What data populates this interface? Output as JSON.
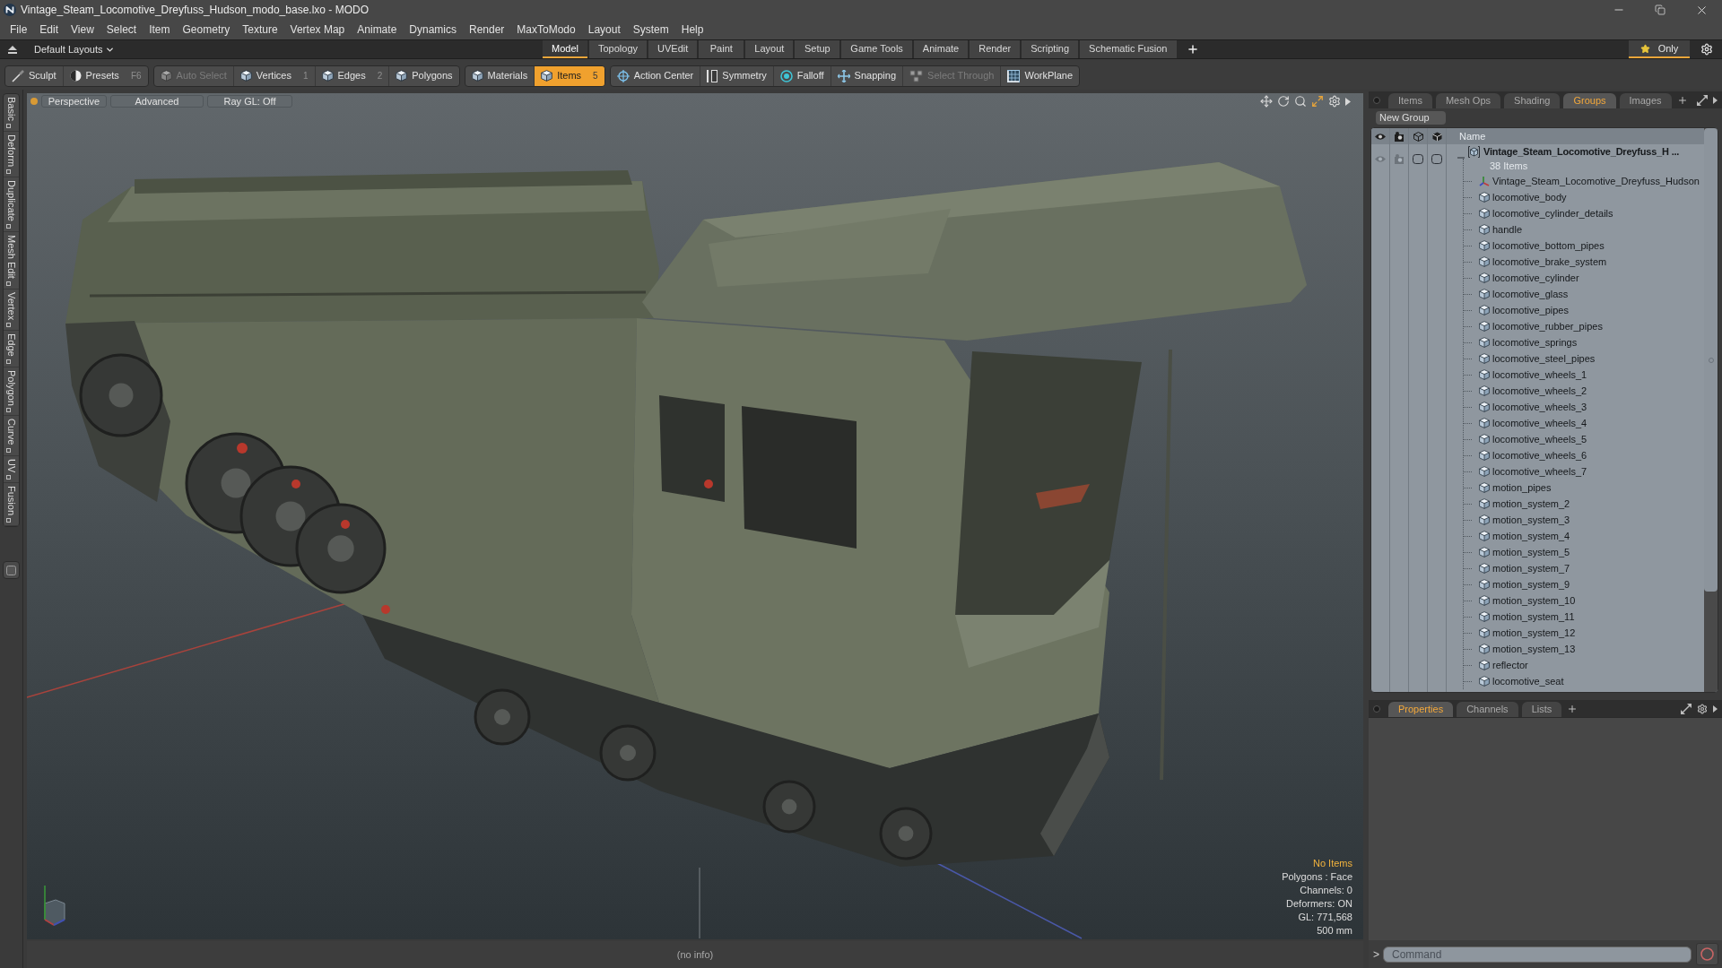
{
  "window": {
    "title": "Vintage_Steam_Locomotive_Dreyfuss_Hudson_modo_base.lxo - MODO"
  },
  "menu": [
    "File",
    "Edit",
    "View",
    "Select",
    "Item",
    "Geometry",
    "Texture",
    "Vertex Map",
    "Animate",
    "Dynamics",
    "Render",
    "MaxToModo",
    "Layout",
    "System",
    "Help"
  ],
  "layout_bar": {
    "layout_menu": "Default Layouts",
    "tabs": [
      {
        "label": "Model",
        "selected": true
      },
      {
        "label": "Topology",
        "selected": false
      },
      {
        "label": "UVEdit",
        "selected": false
      },
      {
        "label": "Paint",
        "selected": false
      },
      {
        "label": "Layout",
        "selected": false
      },
      {
        "label": "Setup",
        "selected": false
      },
      {
        "label": "Game Tools",
        "selected": false
      },
      {
        "label": "Animate",
        "selected": false
      },
      {
        "label": "Render",
        "selected": false
      },
      {
        "label": "Scripting",
        "selected": false
      },
      {
        "label": "Schematic Fusion",
        "selected": false
      }
    ],
    "only_button": {
      "label": "Only",
      "on": true
    }
  },
  "toolbar": {
    "groups": [
      {
        "items": [
          {
            "label": "Sculpt",
            "selected": false,
            "disabled": false
          },
          {
            "label": "Presets",
            "shortcut": "F6",
            "selected": false,
            "disabled": false
          }
        ]
      },
      {
        "items": [
          {
            "label": "Auto Select",
            "selected": false,
            "disabled": true
          },
          {
            "label": "Vertices",
            "shortcut": "1",
            "selected": false,
            "disabled": false
          },
          {
            "label": "Edges",
            "shortcut": "2",
            "selected": false,
            "disabled": false
          },
          {
            "label": "Polygons",
            "selected": false,
            "disabled": false
          }
        ]
      },
      {
        "items": [
          {
            "label": "Materials",
            "selected": false,
            "disabled": false
          },
          {
            "label": "Items",
            "shortcut": "5",
            "selected": true,
            "disabled": false
          }
        ]
      },
      {
        "items": [
          {
            "label": "Action Center",
            "selected": false,
            "disabled": false
          },
          {
            "label": "Symmetry",
            "selected": false,
            "disabled": false
          },
          {
            "label": "Falloff",
            "selected": false,
            "disabled": false
          },
          {
            "label": "Snapping",
            "selected": false,
            "disabled": false
          },
          {
            "label": "Select Through",
            "selected": false,
            "disabled": true
          },
          {
            "label": "WorkPlane",
            "selected": false,
            "disabled": false
          }
        ]
      }
    ]
  },
  "side_tabs": [
    "Basic",
    "Deform",
    "Duplicate",
    "Mesh Edit",
    "Vertex",
    "Edge",
    "Polygon",
    "Curve",
    "UV",
    "Fusion"
  ],
  "viewport": {
    "header": [
      "Perspective",
      "Advanced",
      "Ray GL: Off"
    ],
    "info": {
      "selection": "No Items",
      "lines": [
        "Polygons : Face",
        "Channels: 0",
        "Deformers: ON",
        "GL: 771,568",
        "500 mm"
      ]
    }
  },
  "status_bar": {
    "text": "(no info)"
  },
  "right_panel": {
    "tabs": [
      {
        "label": "Items",
        "selected": false
      },
      {
        "label": "Mesh Ops",
        "selected": false
      },
      {
        "label": "Shading",
        "selected": false
      },
      {
        "label": "Groups",
        "selected": true
      },
      {
        "label": "Images",
        "selected": false
      }
    ],
    "new_group_button": "New Group",
    "name_column": "Name",
    "groups": [
      {
        "name": "Vintage_Steam_Locomotive_Dreyfuss_H ...",
        "count": "38 Items",
        "expanded": true,
        "children": [
          {
            "label": "Vintage_Steam_Locomotive_Dreyfuss_Hudson",
            "kind": "locator"
          },
          {
            "label": "locomotive_body",
            "kind": "mesh"
          },
          {
            "label": "locomotive_cylinder_details",
            "kind": "mesh"
          },
          {
            "label": "handle",
            "kind": "mesh"
          },
          {
            "label": "locomotive_bottom_pipes",
            "kind": "mesh"
          },
          {
            "label": "locomotive_brake_system",
            "kind": "mesh"
          },
          {
            "label": "locomotive_cylinder",
            "kind": "mesh"
          },
          {
            "label": "locomotive_glass",
            "kind": "mesh"
          },
          {
            "label": "locomotive_pipes",
            "kind": "mesh"
          },
          {
            "label": "locomotive_rubber_pipes",
            "kind": "mesh"
          },
          {
            "label": "locomotive_springs",
            "kind": "mesh"
          },
          {
            "label": "locomotive_steel_pipes",
            "kind": "mesh"
          },
          {
            "label": "locomotive_wheels_1",
            "kind": "mesh"
          },
          {
            "label": "locomotive_wheels_2",
            "kind": "mesh"
          },
          {
            "label": "locomotive_wheels_3",
            "kind": "mesh"
          },
          {
            "label": "locomotive_wheels_4",
            "kind": "mesh"
          },
          {
            "label": "locomotive_wheels_5",
            "kind": "mesh"
          },
          {
            "label": "locomotive_wheels_6",
            "kind": "mesh"
          },
          {
            "label": "locomotive_wheels_7",
            "kind": "mesh"
          },
          {
            "label": "motion_pipes",
            "kind": "mesh"
          },
          {
            "label": "motion_system_2",
            "kind": "mesh"
          },
          {
            "label": "motion_system_3",
            "kind": "mesh"
          },
          {
            "label": "motion_system_4",
            "kind": "mesh"
          },
          {
            "label": "motion_system_5",
            "kind": "mesh"
          },
          {
            "label": "motion_system_7",
            "kind": "mesh"
          },
          {
            "label": "motion_system_9",
            "kind": "mesh"
          },
          {
            "label": "motion_system_10",
            "kind": "mesh"
          },
          {
            "label": "motion_system_11",
            "kind": "mesh"
          },
          {
            "label": "motion_system_12",
            "kind": "mesh"
          },
          {
            "label": "motion_system_13",
            "kind": "mesh"
          },
          {
            "label": "reflector",
            "kind": "mesh"
          },
          {
            "label": "locomotive_seat",
            "kind": "mesh"
          }
        ]
      }
    ]
  },
  "bottom_panel": {
    "tabs": [
      {
        "label": "Properties",
        "selected": true
      },
      {
        "label": "Channels",
        "selected": false
      },
      {
        "label": "Lists",
        "selected": false
      }
    ]
  },
  "command_line": {
    "prompt": ">",
    "placeholder": "Command"
  }
}
